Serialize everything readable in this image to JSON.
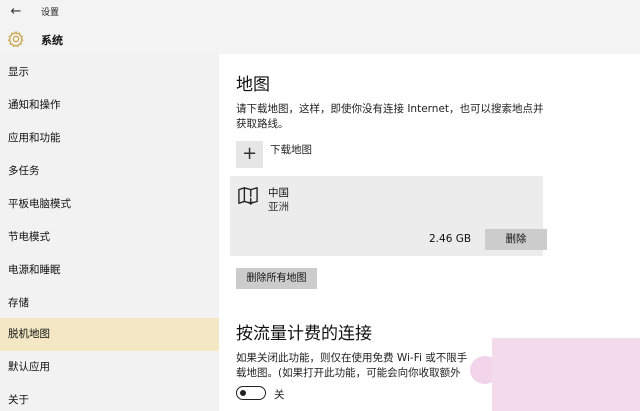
{
  "app": {
    "back_glyph": "←",
    "title": "设置",
    "section": "系统"
  },
  "sidebar": {
    "items": [
      {
        "label": "显示"
      },
      {
        "label": "通知和操作"
      },
      {
        "label": "应用和功能"
      },
      {
        "label": "多任务"
      },
      {
        "label": "平板电脑模式"
      },
      {
        "label": "节电模式"
      },
      {
        "label": "电源和睡眠"
      },
      {
        "label": "存储"
      },
      {
        "label": "脱机地图"
      },
      {
        "label": "默认应用"
      },
      {
        "label": "关于"
      }
    ],
    "active_label": "脱机地图"
  },
  "content": {
    "heading": "地图",
    "description": "请下载地图，这样，即使你没有连接 Internet，也可以搜索地点并获取路线。",
    "add_glyph": "+",
    "add_label": "下载地图",
    "map": {
      "icon": "map-download-icon",
      "name": "中国",
      "region": "亚洲",
      "size": "2.46 GB",
      "delete_label": "删除"
    },
    "delete_all_label": "删除所有地图",
    "metered_heading": "按流量计费的连接",
    "metered_description_line1": "如果关闭此功能，则仅在使用免费 Wi-Fi 或不限手",
    "metered_description_line2": "载地图。(如果打开此功能，可能会向你收取额外",
    "toggle_state": "关"
  },
  "colors": {
    "sidebar_bg": "#f2f2f2",
    "active_item_bg": "#f3e8c3",
    "button_bg": "#cccccc",
    "card_bg": "#ececec"
  }
}
